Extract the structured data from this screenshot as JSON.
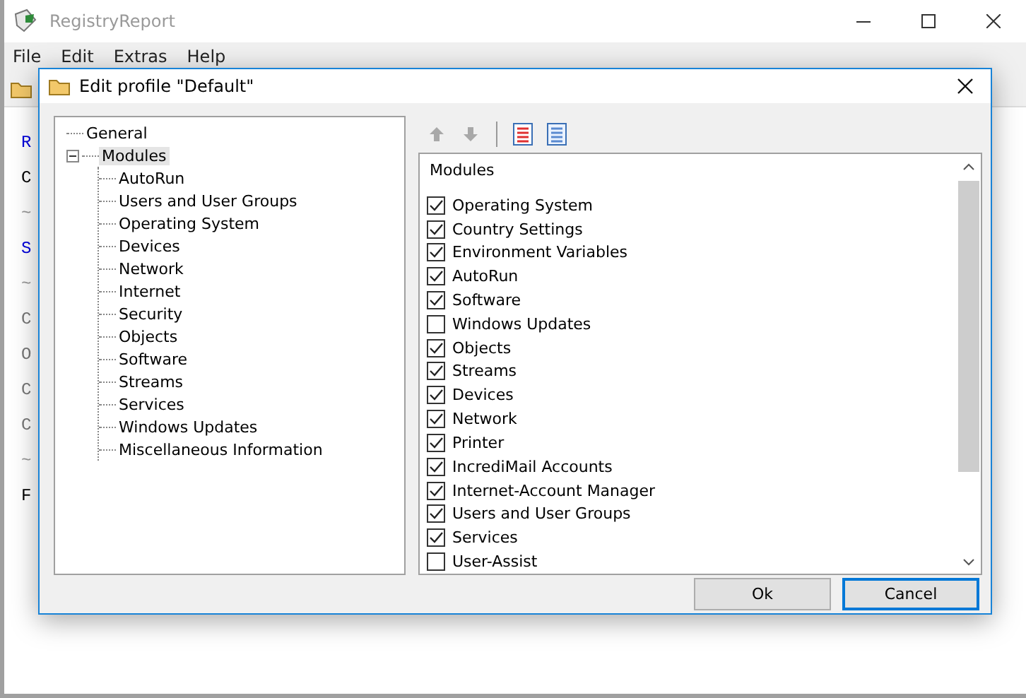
{
  "app": {
    "title": "RegistryReport",
    "menu": [
      "File",
      "Edit",
      "Extras",
      "Help"
    ],
    "background_lines": [
      {
        "text": "R",
        "kind": "heading"
      },
      {
        "text": "C",
        "kind": "plain"
      },
      {
        "text": "~",
        "kind": "rule"
      },
      {
        "text": "S",
        "kind": "heading"
      },
      {
        "text": "~",
        "kind": "rule"
      },
      {
        "text": "C",
        "kind": "dim"
      },
      {
        "text": "O",
        "kind": "dim"
      },
      {
        "text": "C",
        "kind": "dim"
      },
      {
        "text": "C",
        "kind": "dim"
      },
      {
        "text": "~",
        "kind": "rule"
      },
      {
        "text": "F",
        "kind": "plain"
      }
    ]
  },
  "dialog": {
    "title": "Edit profile \"Default\"",
    "tree": [
      {
        "label": "General",
        "selected": false
      },
      {
        "label": "Modules",
        "selected": true,
        "expanded": true,
        "children": [
          {
            "label": "AutoRun",
            "selected": false
          },
          {
            "label": "Users and User Groups",
            "selected": false
          },
          {
            "label": "Operating System",
            "selected": false
          },
          {
            "label": "Devices",
            "selected": false
          },
          {
            "label": "Network",
            "selected": false
          },
          {
            "label": "Internet",
            "selected": false
          },
          {
            "label": "Security",
            "selected": false
          },
          {
            "label": "Objects",
            "selected": false
          },
          {
            "label": "Software",
            "selected": false
          },
          {
            "label": "Streams",
            "selected": false
          },
          {
            "label": "Services",
            "selected": false
          },
          {
            "label": "Windows Updates",
            "selected": false
          },
          {
            "label": "Miscellaneous Information",
            "selected": false
          }
        ]
      }
    ],
    "toolbar": [
      {
        "kind": "up",
        "disabled": true
      },
      {
        "kind": "down",
        "disabled": true
      },
      {
        "kind": "separator"
      },
      {
        "kind": "check-all"
      },
      {
        "kind": "uncheck-all"
      }
    ],
    "list_header": "Modules",
    "modules": [
      {
        "label": "Operating System",
        "checked": true
      },
      {
        "label": "Country Settings",
        "checked": true
      },
      {
        "label": "Environment Variables",
        "checked": true
      },
      {
        "label": "AutoRun",
        "checked": true
      },
      {
        "label": "Software",
        "checked": true
      },
      {
        "label": "Windows Updates",
        "checked": false
      },
      {
        "label": "Objects",
        "checked": true
      },
      {
        "label": "Streams",
        "checked": true
      },
      {
        "label": "Devices",
        "checked": true
      },
      {
        "label": "Network",
        "checked": true
      },
      {
        "label": "Printer",
        "checked": true
      },
      {
        "label": "IncrediMail Accounts",
        "checked": true
      },
      {
        "label": "Internet-Account Manager",
        "checked": true
      },
      {
        "label": "Users and User Groups",
        "checked": true
      },
      {
        "label": "Services",
        "checked": true
      },
      {
        "label": "User-Assist",
        "checked": false
      }
    ],
    "buttons": [
      {
        "label": "Ok",
        "default": false
      },
      {
        "label": "Cancel",
        "default": true
      }
    ]
  }
}
